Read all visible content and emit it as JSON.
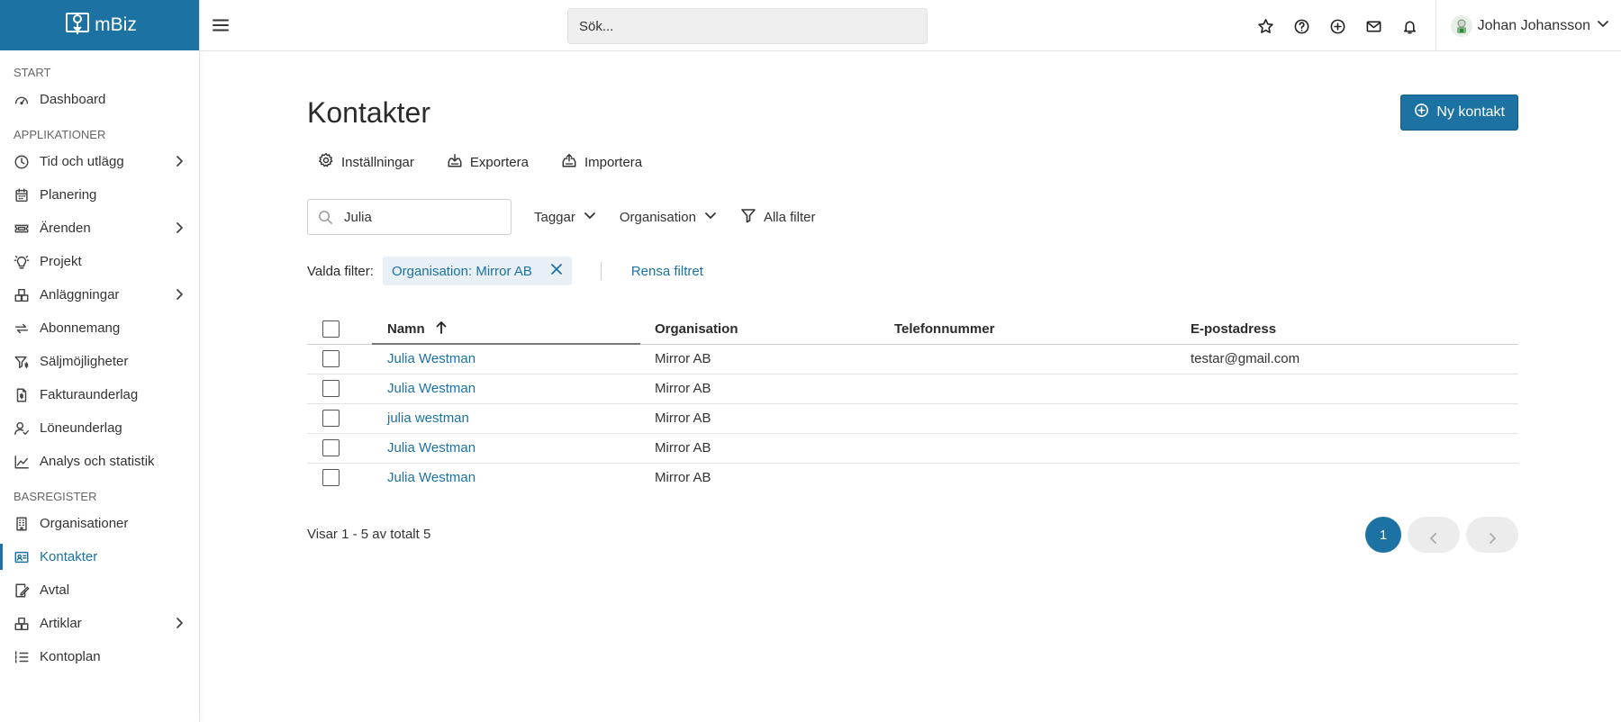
{
  "app": {
    "brand": "mBiz"
  },
  "topbar": {
    "search_placeholder": "Sök...",
    "user_name": "Johan Johansson"
  },
  "sidebar": {
    "sections": {
      "start": "START",
      "apps": "APPLIKATIONER",
      "base": "BASREGISTER"
    },
    "items": [
      {
        "label": "Dashboard"
      },
      {
        "label": "Tid och utlägg"
      },
      {
        "label": "Planering"
      },
      {
        "label": "Ärenden"
      },
      {
        "label": "Projekt"
      },
      {
        "label": "Anläggningar"
      },
      {
        "label": "Abonnemang"
      },
      {
        "label": "Säljmöjligheter"
      },
      {
        "label": "Fakturaunderlag"
      },
      {
        "label": "Löneunderlag"
      },
      {
        "label": "Analys och statistik"
      },
      {
        "label": "Organisationer"
      },
      {
        "label": "Kontakter"
      },
      {
        "label": "Avtal"
      },
      {
        "label": "Artiklar"
      },
      {
        "label": "Kontoplan"
      }
    ]
  },
  "page": {
    "title": "Kontakter",
    "new_button": "Ny kontakt",
    "actions": {
      "settings": "Inställningar",
      "export": "Exportera",
      "import": "Importera"
    },
    "filters": {
      "search_value": "Julia",
      "tags": "Taggar",
      "organisation": "Organisation",
      "all_filters": "Alla filter"
    },
    "chosen": {
      "label": "Valda filter:",
      "chip": "Organisation: Mirror AB",
      "clear": "Rensa filtret"
    },
    "table": {
      "headers": {
        "name": "Namn",
        "org": "Organisation",
        "phone": "Telefonnummer",
        "email": "E-postadress"
      },
      "rows": [
        {
          "name": "Julia Westman",
          "org": "Mirror AB",
          "phone": "",
          "email": "testar@gmail.com"
        },
        {
          "name": "Julia Westman",
          "org": "Mirror AB",
          "phone": "",
          "email": ""
        },
        {
          "name": "julia westman",
          "org": "Mirror AB",
          "phone": "",
          "email": ""
        },
        {
          "name": "Julia Westman",
          "org": "Mirror AB",
          "phone": "",
          "email": ""
        },
        {
          "name": "Julia Westman",
          "org": "Mirror AB",
          "phone": "",
          "email": ""
        }
      ]
    },
    "summary": "Visar 1 - 5 av totalt 5",
    "pagination": {
      "current": "1"
    }
  },
  "colors": {
    "accent": "#1c72a2",
    "chip_bg": "#e8f0f6"
  }
}
